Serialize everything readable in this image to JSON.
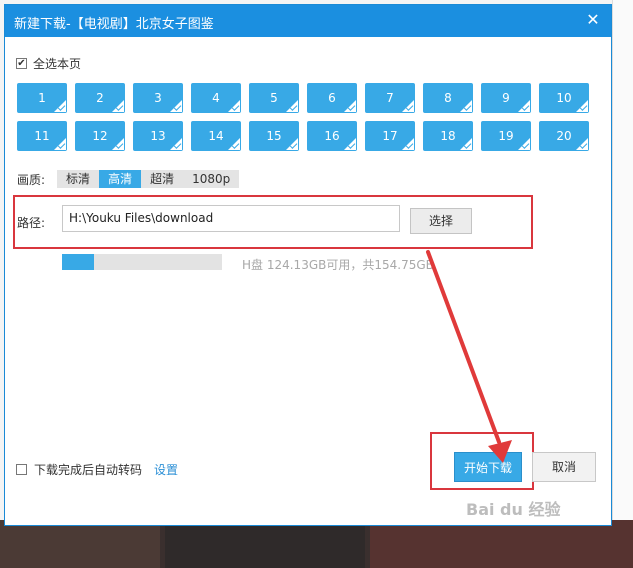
{
  "dialog": {
    "title": "新建下载-【电视剧】北京女子图鉴",
    "close_glyph": "✕"
  },
  "select_all": {
    "label": "全选本页",
    "checked": true,
    "check_glyph": "✔"
  },
  "episodes": [
    "1",
    "2",
    "3",
    "4",
    "5",
    "6",
    "7",
    "8",
    "9",
    "10",
    "11",
    "12",
    "13",
    "14",
    "15",
    "16",
    "17",
    "18",
    "19",
    "20"
  ],
  "quality": {
    "label": "画质:",
    "options": [
      "标清",
      "高清",
      "超清",
      "1080p"
    ],
    "selected": "高清"
  },
  "path": {
    "label": "路径:",
    "value": "H:\\Youku Files\\download",
    "choose_label": "选择"
  },
  "disk": {
    "used_fraction": 0.2,
    "info": "H盘 124.13GB可用，共154.75GB"
  },
  "auto_transcode": {
    "label": "下载完成后自动转码",
    "checked": false,
    "settings_label": "设置"
  },
  "buttons": {
    "start": "开始下载",
    "cancel": "取消"
  },
  "watermark": "Bai du 经验",
  "colors": {
    "titlebar": "#1b8fe0",
    "accent": "#38a9e6",
    "highlight": "#d9363e"
  }
}
